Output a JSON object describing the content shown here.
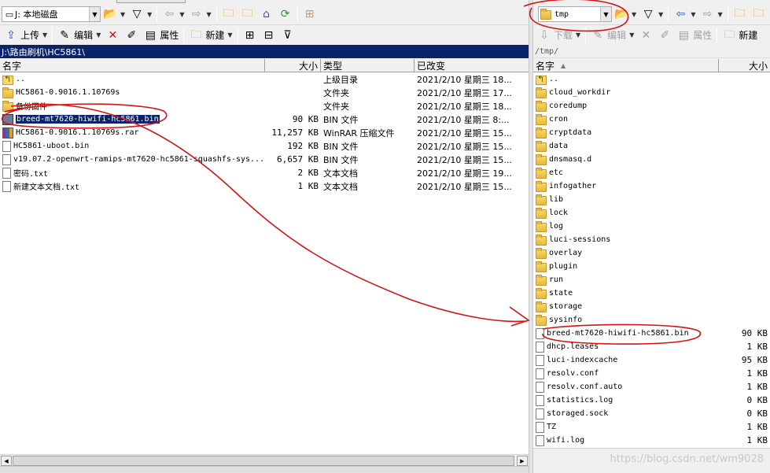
{
  "left": {
    "drive_label": "J: 本地磁盘",
    "toolbar": {
      "upload": "上传",
      "edit": "编辑",
      "properties": "属性",
      "new": "新建"
    },
    "path": "J:\\路由刷机\\HC5861\\",
    "columns": {
      "name": "名字",
      "size": "大小",
      "type": "类型",
      "modified": "已改变"
    },
    "rows": [
      {
        "icon": "up",
        "name": "..",
        "size": "",
        "type": "上级目录",
        "modified": "2021/2/10 星期三 18..."
      },
      {
        "icon": "folder",
        "name": "HC5861-0.9016.1.10769s",
        "size": "",
        "type": "文件夹",
        "modified": "2021/2/10 星期三 17..."
      },
      {
        "icon": "folder",
        "name": "备份固件",
        "size": "",
        "type": "文件夹",
        "modified": "2021/2/10 星期三 18..."
      },
      {
        "icon": "binsel",
        "name": "breed-mt7620-hiwifi-hc5861.bin",
        "size": "90 KB",
        "type": "BIN 文件",
        "modified": "2021/2/10 星期三 8:...",
        "selected": true
      },
      {
        "icon": "rar",
        "name": "HC5861-0.9016.1.10769s.rar",
        "size": "11,257 KB",
        "type": "WinRAR 压缩文件",
        "modified": "2021/2/10 星期三 15..."
      },
      {
        "icon": "file",
        "name": "HC5861-uboot.bin",
        "size": "192 KB",
        "type": "BIN 文件",
        "modified": "2021/2/10 星期三 15..."
      },
      {
        "icon": "file",
        "name": "v19.07.2-openwrt-ramips-mt7620-hc5861-squashfs-sys...",
        "size": "6,657 KB",
        "type": "BIN 文件",
        "modified": "2021/2/10 星期三 15..."
      },
      {
        "icon": "file",
        "name": "密码.txt",
        "size": "2 KB",
        "type": "文本文档",
        "modified": "2021/2/10 星期三 19..."
      },
      {
        "icon": "file",
        "name": "新建文本文档.txt",
        "size": "1 KB",
        "type": "文本文档",
        "modified": "2021/2/10 星期三 15..."
      }
    ]
  },
  "right": {
    "drive_label": "tmp",
    "toolbar": {
      "download": "下载",
      "edit": "编辑",
      "properties": "属性",
      "new": "新建"
    },
    "path": "/tmp/",
    "columns": {
      "name": "名字",
      "size": "大小"
    },
    "rows": [
      {
        "icon": "up",
        "name": "..",
        "size": ""
      },
      {
        "icon": "folder",
        "name": "cloud_workdir",
        "size": ""
      },
      {
        "icon": "folder",
        "name": "coredump",
        "size": ""
      },
      {
        "icon": "folder",
        "name": "cron",
        "size": ""
      },
      {
        "icon": "folder",
        "name": "cryptdata",
        "size": ""
      },
      {
        "icon": "folder",
        "name": "data",
        "size": ""
      },
      {
        "icon": "folder",
        "name": "dnsmasq.d",
        "size": ""
      },
      {
        "icon": "folder",
        "name": "etc",
        "size": ""
      },
      {
        "icon": "folder",
        "name": "infogather",
        "size": ""
      },
      {
        "icon": "folder",
        "name": "lib",
        "size": ""
      },
      {
        "icon": "folder",
        "name": "lock",
        "size": ""
      },
      {
        "icon": "folder",
        "name": "log",
        "size": ""
      },
      {
        "icon": "folder",
        "name": "luci-sessions",
        "size": ""
      },
      {
        "icon": "folder",
        "name": "overlay",
        "size": ""
      },
      {
        "icon": "folder",
        "name": "plugin",
        "size": ""
      },
      {
        "icon": "folder",
        "name": "run",
        "size": ""
      },
      {
        "icon": "folder",
        "name": "state",
        "size": ""
      },
      {
        "icon": "folder",
        "name": "storage",
        "size": ""
      },
      {
        "icon": "folder",
        "name": "sysinfo",
        "size": ""
      },
      {
        "icon": "file",
        "name": "breed-mt7620-hiwifi-hc5861.bin",
        "size": "90 KB"
      },
      {
        "icon": "file",
        "name": "dhcp.leases",
        "size": "1 KB"
      },
      {
        "icon": "file",
        "name": "luci-indexcache",
        "size": "95 KB"
      },
      {
        "icon": "file",
        "name": "resolv.conf",
        "size": "1 KB"
      },
      {
        "icon": "file",
        "name": "resolv.conf.auto",
        "size": "1 KB"
      },
      {
        "icon": "file",
        "name": "statistics.log",
        "size": "0 KB"
      },
      {
        "icon": "file",
        "name": "storaged.sock",
        "size": "0 KB"
      },
      {
        "icon": "file",
        "name": "TZ",
        "size": "1 KB"
      },
      {
        "icon": "file",
        "name": "wifi.log",
        "size": "1 KB"
      }
    ]
  },
  "watermark": "https://blog.csdn.net/wm9028",
  "colors": {
    "selection": "#0a246a",
    "annotation": "#d21414",
    "folder": "#e7b93b"
  }
}
